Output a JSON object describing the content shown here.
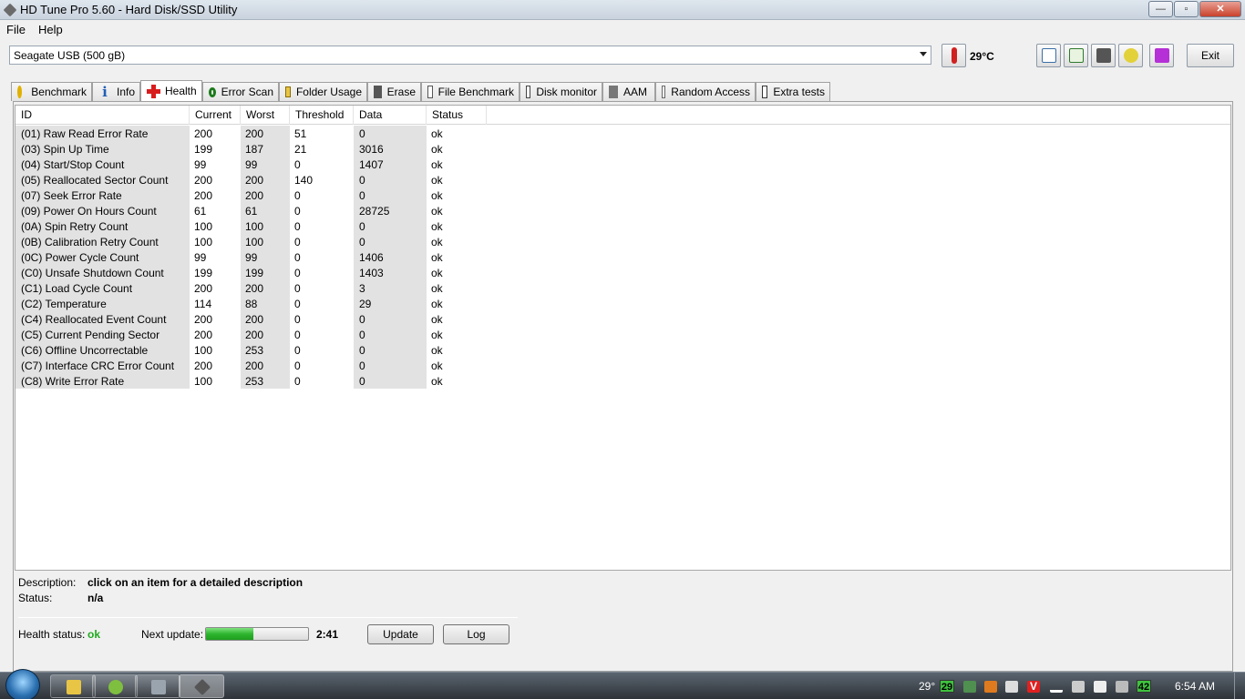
{
  "window": {
    "title": "HD Tune Pro 5.60 - Hard Disk/SSD Utility"
  },
  "menu": [
    {
      "label": "File"
    },
    {
      "label": "Help"
    }
  ],
  "toolbar": {
    "drive": "Seagate USB (500 gB)",
    "temperature": "29°C",
    "exit_label": "Exit",
    "buttons": [
      "copy-info-icon",
      "copy-clipboard-icon",
      "screenshot-camera-icon",
      "options-icon",
      "save-download-icon"
    ]
  },
  "tabs": [
    {
      "label": "Benchmark",
      "icon": "benchmark-icon"
    },
    {
      "label": "Info",
      "icon": "info-icon"
    },
    {
      "label": "Health",
      "icon": "health-cross-icon",
      "active": true
    },
    {
      "label": "Error Scan",
      "icon": "error-scan-icon"
    },
    {
      "label": "Folder Usage",
      "icon": "folder-icon"
    },
    {
      "label": "Erase",
      "icon": "erase-bin-icon"
    },
    {
      "label": "File Benchmark",
      "icon": "file-benchmark-icon"
    },
    {
      "label": "Disk monitor",
      "icon": "disk-monitor-icon"
    },
    {
      "label": "AAM",
      "icon": "speaker-icon"
    },
    {
      "label": "Random Access",
      "icon": "random-access-icon"
    },
    {
      "label": "Extra tests",
      "icon": "extra-tests-icon"
    }
  ],
  "smart": {
    "columns": [
      "ID",
      "Current",
      "Worst",
      "Threshold",
      "Data",
      "Status"
    ],
    "rows": [
      [
        "(01) Raw Read Error Rate",
        "200",
        "200",
        "51",
        "0",
        "ok"
      ],
      [
        "(03) Spin Up Time",
        "199",
        "187",
        "21",
        "3016",
        "ok"
      ],
      [
        "(04) Start/Stop Count",
        "99",
        "99",
        "0",
        "1407",
        "ok"
      ],
      [
        "(05) Reallocated Sector Count",
        "200",
        "200",
        "140",
        "0",
        "ok"
      ],
      [
        "(07) Seek Error Rate",
        "200",
        "200",
        "0",
        "0",
        "ok"
      ],
      [
        "(09) Power On Hours Count",
        "61",
        "61",
        "0",
        "28725",
        "ok"
      ],
      [
        "(0A) Spin Retry Count",
        "100",
        "100",
        "0",
        "0",
        "ok"
      ],
      [
        "(0B) Calibration Retry Count",
        "100",
        "100",
        "0",
        "0",
        "ok"
      ],
      [
        "(0C) Power Cycle Count",
        "99",
        "99",
        "0",
        "1406",
        "ok"
      ],
      [
        "(C0) Unsafe Shutdown Count",
        "199",
        "199",
        "0",
        "1403",
        "ok"
      ],
      [
        "(C1) Load Cycle Count",
        "200",
        "200",
        "0",
        "3",
        "ok"
      ],
      [
        "(C2) Temperature",
        "114",
        "88",
        "0",
        "29",
        "ok"
      ],
      [
        "(C4) Reallocated Event Count",
        "200",
        "200",
        "0",
        "0",
        "ok"
      ],
      [
        "(C5) Current Pending Sector",
        "200",
        "200",
        "0",
        "0",
        "ok"
      ],
      [
        "(C6) Offline Uncorrectable",
        "100",
        "253",
        "0",
        "0",
        "ok"
      ],
      [
        "(C7) Interface CRC Error Count",
        "200",
        "200",
        "0",
        "0",
        "ok"
      ],
      [
        "(C8) Write Error Rate",
        "100",
        "253",
        "0",
        "0",
        "ok"
      ]
    ]
  },
  "details": {
    "description_label": "Description:",
    "description_value": "click on an item for a detailed description",
    "status_label": "Status:",
    "status_value": "n/a"
  },
  "footer": {
    "health_label": "Health status:",
    "health_value": "ok",
    "next_update_label": "Next update:",
    "progress": 0.46,
    "countdown": "2:41",
    "update_label": "Update",
    "log_label": "Log"
  },
  "taskbar": {
    "tray_temp": "29°",
    "tray_box1": "29",
    "tray_box2": "42",
    "clock": "6:54 AM"
  },
  "colors": {
    "health_ok": "#1eaa1e",
    "progress": "#2fb52f"
  }
}
